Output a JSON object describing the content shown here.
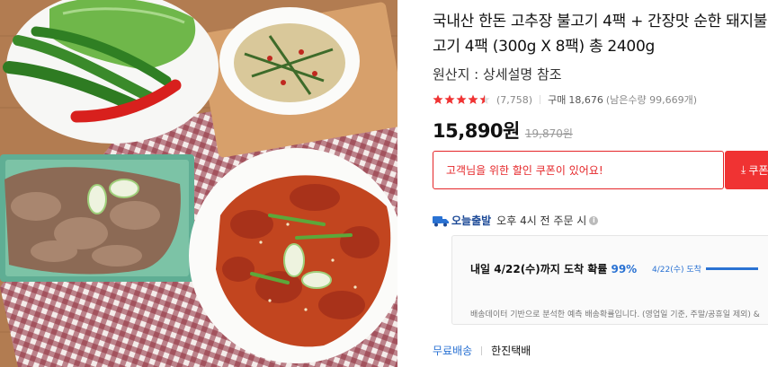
{
  "product": {
    "title": "국내산 한돈 고추장 불고기 4팩 + 간장맛 순한 돼지불고기 4팩 (300g X 8팩) 총 2400g",
    "origin": "원산지 : 상세설명 참조",
    "rating": 4.5,
    "review_count": "(7,758)",
    "purchase_label": "구매",
    "purchase_count": "18,676",
    "remaining": "(남은수량 99,669개)",
    "price": "15,890원",
    "original_price": "19,870원"
  },
  "coupon": {
    "message": "고객님을 위한 할인 쿠폰이 있어요!",
    "button_label": "쿠폰"
  },
  "delivery": {
    "label": "오늘출발",
    "cutoff": "오후 4시 전 주문 시",
    "arrival_text": "내일 4/22(수)까지 도착 확률",
    "arrival_pct": "99%",
    "chart_label": "4/22(수) 도착",
    "note": "배송데이터 기반으로 분석한 예측 배송확률입니다. (영업일 기준, 주말/공휴일 제외) &"
  },
  "shipping": {
    "fee": "무료배송",
    "carrier": "한진택배"
  },
  "colors": {
    "accent_red": "#e52528",
    "accent_blue": "#2a72d3",
    "today_blue": "#1d4a97",
    "star_red": "#f03333"
  },
  "icons": {
    "star": "star-icon",
    "truck": "truck-icon",
    "info": "info-icon",
    "download": "download-icon"
  }
}
